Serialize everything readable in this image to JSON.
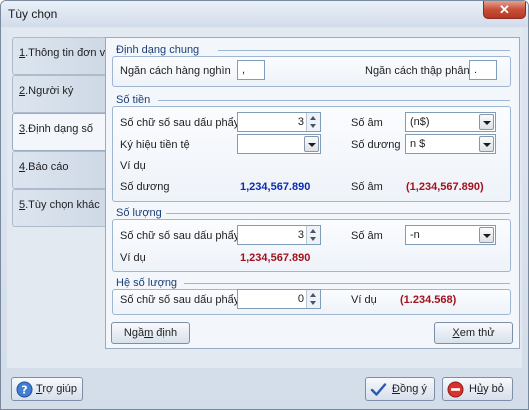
{
  "window": {
    "title": "Tùy chọn",
    "close_label": "✕"
  },
  "tabs": [
    {
      "hotkey": "1",
      "label": ".Thông tin đơn vị"
    },
    {
      "hotkey": "2",
      "label": ".Người ký"
    },
    {
      "hotkey": "3",
      "label": ".Định dạng số"
    },
    {
      "hotkey": "4",
      "label": ".Báo cáo"
    },
    {
      "hotkey": "5",
      "label": ".Tùy chọn khác"
    }
  ],
  "active_tab": 2,
  "general": {
    "title": "Định dạng chung",
    "thousands_label": "Ngăn cách hàng nghìn",
    "thousands_value": ",",
    "decimal_label": "Ngăn cách thập phân",
    "decimal_value": "."
  },
  "currency": {
    "title": "Số tiền",
    "decimals_label": "Số chữ số sau dấu phẩy",
    "decimals_value": "3",
    "symbol_label": "Ký hiệu tiền tệ",
    "symbol_value": "",
    "negative_label": "Số âm",
    "negative_value": "(n$)",
    "positive_label": "Số dương",
    "positive_value": "n $",
    "example_label": "Ví dụ",
    "example_positive_label": "Số dương",
    "example_positive_value": "1,234,567.890",
    "example_negative_label": "Số âm",
    "example_negative_value": "(1,234,567.890)"
  },
  "quantity": {
    "title": "Số lượng",
    "decimals_label": "Số chữ số sau dấu phẩy",
    "decimals_value": "3",
    "negative_label": "Số âm",
    "negative_value": "-n",
    "example_label": "Ví dụ",
    "example_value": "1,234,567.890"
  },
  "coefficient": {
    "title": "Hệ số lượng",
    "decimals_label": "Số chữ số sau dấu phẩy",
    "decimals_value": "0",
    "example_label": "Ví dụ",
    "example_value": "(1.234.568)"
  },
  "buttons": {
    "default_pre": "Ngầ",
    "default_hk": "m",
    "default_post": " định",
    "preview_hk": "X",
    "preview_post": "em thử",
    "help_hk": "T",
    "help_post": "rợ giúp",
    "ok_hk": "Đ",
    "ok_post": "ồng ý",
    "cancel_pre": "H",
    "cancel_hk": "ủ",
    "cancel_post": "y bỏ"
  },
  "colors": {
    "example_positive": "#0c2cb4",
    "example_negative": "#a3121c",
    "group_title": "#1a3f7a"
  }
}
